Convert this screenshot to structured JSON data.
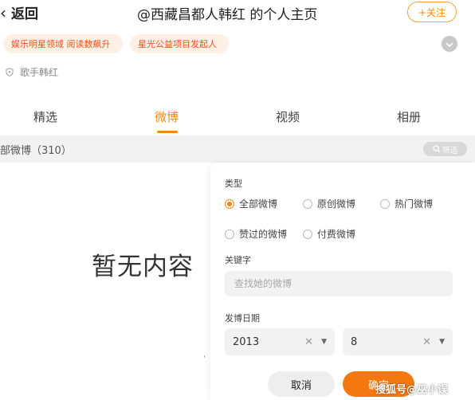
{
  "header": {
    "back_label": "返回",
    "title": "@西藏昌都人韩红 的个人主页",
    "follow_label": "+关注"
  },
  "tags": [
    {
      "label": "娱乐明星领域 阅读数飙升"
    },
    {
      "label": "星光公益项目发起人"
    }
  ],
  "profile": {
    "verified_label": "歌手韩红"
  },
  "tabs": [
    {
      "label": "精选"
    },
    {
      "label": "微博",
      "active": true
    },
    {
      "label": "视频"
    },
    {
      "label": "相册"
    }
  ],
  "filter_bar": {
    "count_text": "部微博（310）",
    "filter_label": "筛选"
  },
  "empty": {
    "text": "暂无内容",
    "stray": "'"
  },
  "filter_panel": {
    "type_label": "类型",
    "options": [
      {
        "label": "全部微博",
        "selected": true
      },
      {
        "label": "原创微博",
        "selected": false
      },
      {
        "label": "热门微博",
        "selected": false
      },
      {
        "label": "赞过的微博",
        "selected": false
      },
      {
        "label": "付费微博",
        "selected": false
      }
    ],
    "keyword_label": "关键字",
    "keyword_placeholder": "查找她的微博",
    "keyword_value": "",
    "date_label": "发博日期",
    "year_value": "2013",
    "month_value": "8",
    "cancel_label": "取消",
    "confirm_label": "确定"
  },
  "watermark": "搜狐号@巫小误",
  "colors": {
    "accent": "#f08a17",
    "tag_bg": "#fff0e6",
    "tag_text": "#e8501a",
    "filter_bar_bg": "#f2f2f2"
  },
  "icons": {
    "back": "chevron-left-icon",
    "expand": "chevron-down-icon",
    "verified": "shield-icon",
    "filter": "search-icon",
    "clear": "close-icon",
    "dropdown": "caret-down-icon"
  }
}
